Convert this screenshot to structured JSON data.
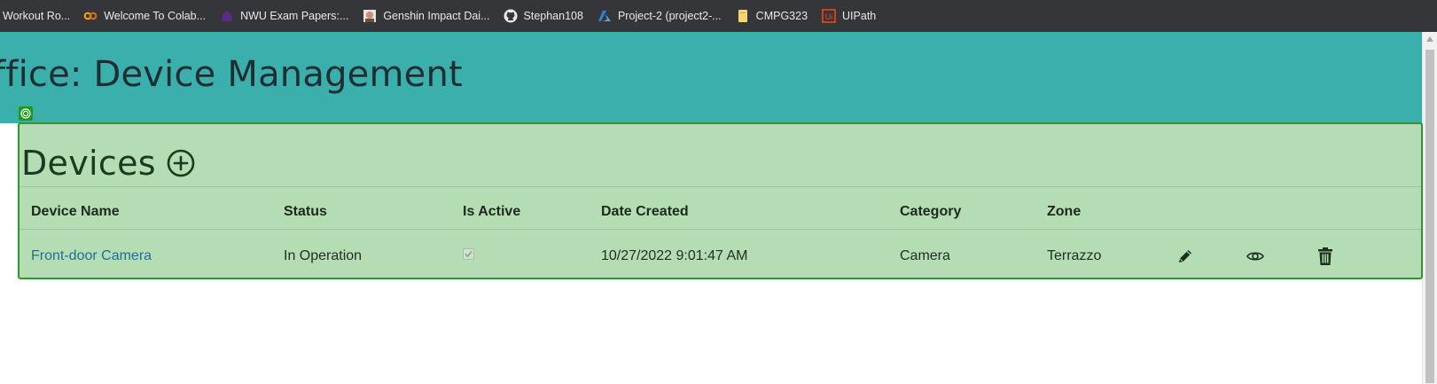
{
  "bookmarks": [
    {
      "label": "Workout Ro...",
      "icon": "none"
    },
    {
      "label": "Welcome To Colab...",
      "icon": "colab-icon"
    },
    {
      "label": "NWU Exam Papers:...",
      "icon": "nwu-icon"
    },
    {
      "label": "Genshin Impact Dai...",
      "icon": "genshin-icon"
    },
    {
      "label": "Stephan108",
      "icon": "github-icon"
    },
    {
      "label": "Project-2 (project2-...",
      "icon": "azure-icon"
    },
    {
      "label": "CMPG323",
      "icon": "folder-icon"
    },
    {
      "label": "UIPath",
      "icon": "uipath-icon"
    }
  ],
  "header": {
    "title": "ffice: Device Management"
  },
  "devices": {
    "title": "Devices",
    "columns": [
      "Device Name",
      "Status",
      "Is Active",
      "Date Created",
      "Category",
      "Zone"
    ],
    "rows": [
      {
        "device_name": "Front-door Camera",
        "status": "In Operation",
        "is_active": true,
        "date_created": "10/27/2022 9:01:47 AM",
        "category": "Camera",
        "zone": "Terrazzo",
        "actions": [
          "pencil-icon",
          "eye-icon",
          "trash-icon"
        ]
      }
    ]
  },
  "colors": {
    "header_bg": "#3bafab",
    "panel_bg": "#b4ddb4",
    "panel_border": "#2b9a2b",
    "link": "#1f6e9a"
  }
}
